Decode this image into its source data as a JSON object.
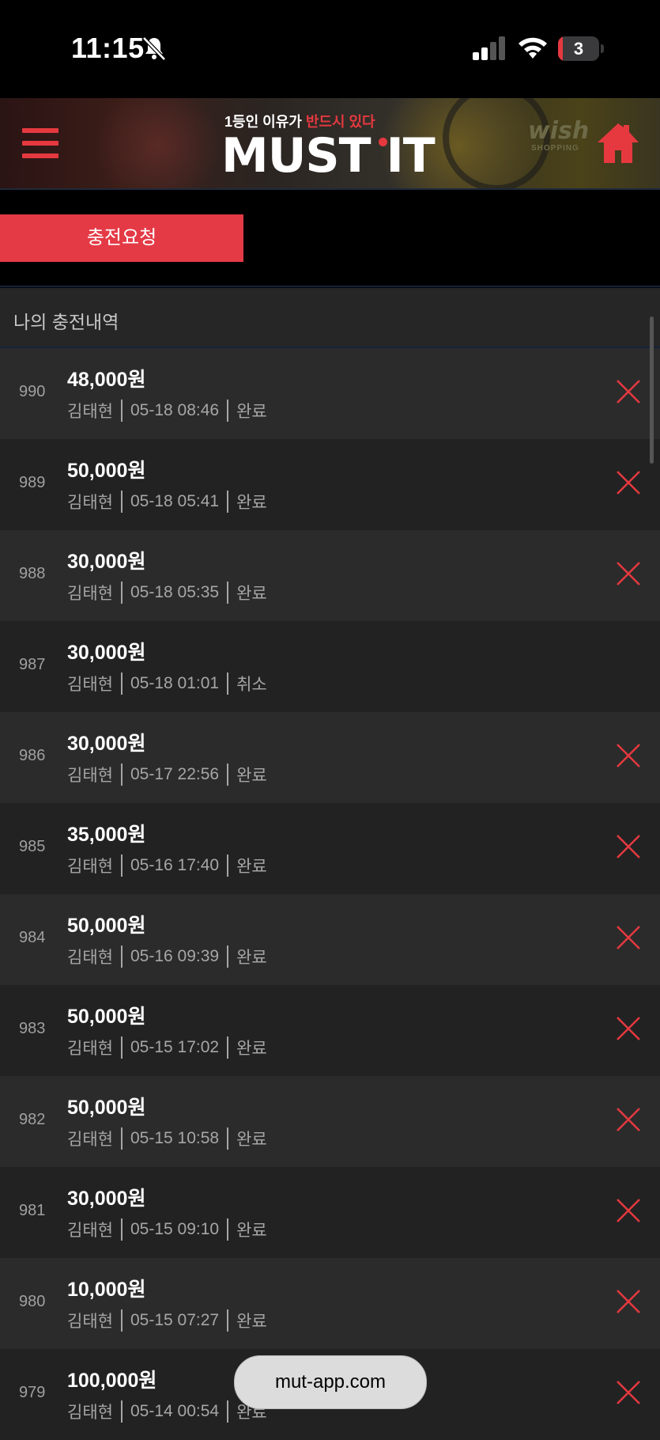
{
  "status_bar": {
    "time": "11:15",
    "battery": "3",
    "battery_level": 0.12,
    "icons": [
      "bell-slash-icon",
      "cellular-signal-icon",
      "wifi-icon",
      "battery-icon"
    ]
  },
  "header": {
    "tagline_pre": "1등인 이유가 ",
    "tagline_highlight": "반드시 있다",
    "brand": "MUST IT",
    "ad_logo": "wish",
    "ad_logo_sub": "SHOPPING",
    "accent_color": "#e5393f"
  },
  "charge_button": {
    "label": "충전요청"
  },
  "history": {
    "title": "나의 충전내역",
    "rows": [
      {
        "num": "990",
        "amount": "48,000원",
        "name": "김태현",
        "datetime": "05-18 08:46",
        "status": "완료",
        "deletable": true
      },
      {
        "num": "989",
        "amount": "50,000원",
        "name": "김태현",
        "datetime": "05-18 05:41",
        "status": "완료",
        "deletable": true
      },
      {
        "num": "988",
        "amount": "30,000원",
        "name": "김태현",
        "datetime": "05-18 05:35",
        "status": "완료",
        "deletable": true
      },
      {
        "num": "987",
        "amount": "30,000원",
        "name": "김태현",
        "datetime": "05-18 01:01",
        "status": "취소",
        "deletable": false
      },
      {
        "num": "986",
        "amount": "30,000원",
        "name": "김태현",
        "datetime": "05-17 22:56",
        "status": "완료",
        "deletable": true
      },
      {
        "num": "985",
        "amount": "35,000원",
        "name": "김태현",
        "datetime": "05-16 17:40",
        "status": "완료",
        "deletable": true
      },
      {
        "num": "984",
        "amount": "50,000원",
        "name": "김태현",
        "datetime": "05-16 09:39",
        "status": "완료",
        "deletable": true
      },
      {
        "num": "983",
        "amount": "50,000원",
        "name": "김태현",
        "datetime": "05-15 17:02",
        "status": "완료",
        "deletable": true
      },
      {
        "num": "982",
        "amount": "50,000원",
        "name": "김태현",
        "datetime": "05-15 10:58",
        "status": "완료",
        "deletable": true
      },
      {
        "num": "981",
        "amount": "30,000원",
        "name": "김태현",
        "datetime": "05-15 09:10",
        "status": "완료",
        "deletable": true
      },
      {
        "num": "980",
        "amount": "10,000원",
        "name": "김태현",
        "datetime": "05-15 07:27",
        "status": "완료",
        "deletable": true
      },
      {
        "num": "979",
        "amount": "100,000원",
        "name": "김태현",
        "datetime": "05-14 00:54",
        "status": "완료",
        "deletable": true
      }
    ]
  },
  "browser": {
    "url": "mut-app.com"
  }
}
